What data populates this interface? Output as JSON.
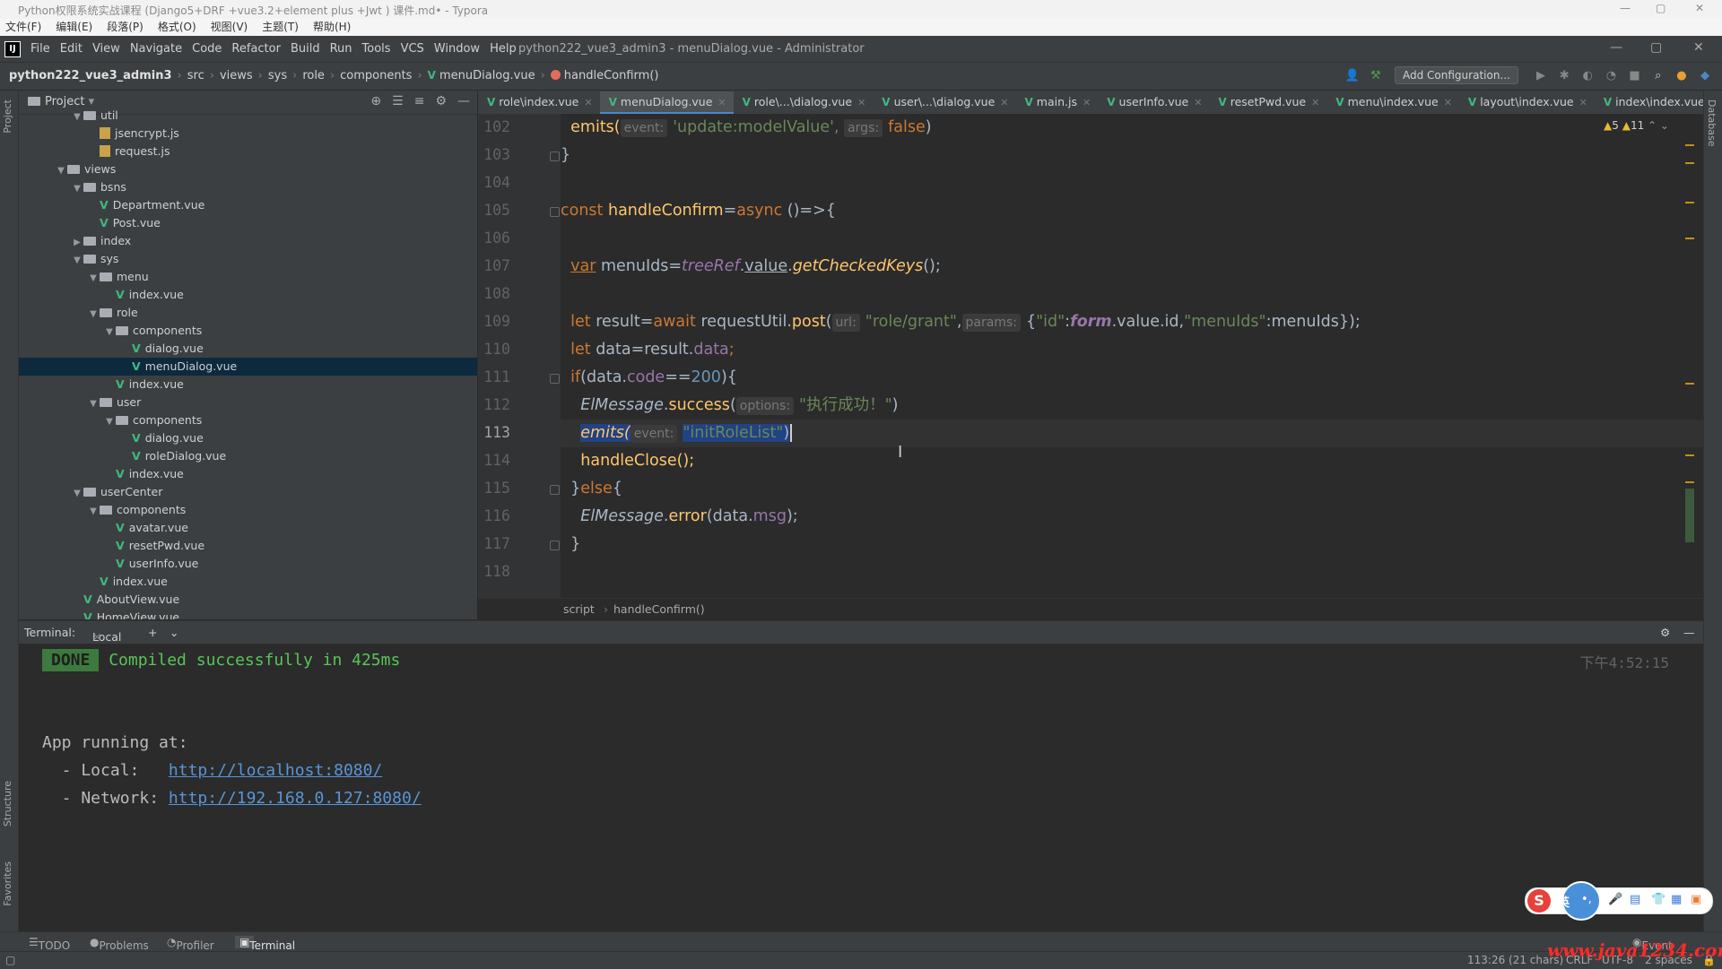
{
  "typora": {
    "title": "Python权限系统实战课程 (Django5+DRF +vue3.2+element plus +Jwt ) 课件.md• - Typora",
    "menu": [
      "文件(F)",
      "编辑(E)",
      "段落(P)",
      "格式(O)",
      "视图(V)",
      "主题(T)",
      "帮助(H)"
    ]
  },
  "ide": {
    "menu": [
      "File",
      "Edit",
      "View",
      "Navigate",
      "Code",
      "Refactor",
      "Build",
      "Run",
      "Tools",
      "VCS",
      "Window",
      "Help"
    ],
    "window_title": "python222_vue3_admin3 - menuDialog.vue - Administrator",
    "breadcrumb": [
      "python222_vue3_admin3",
      "src",
      "views",
      "sys",
      "role",
      "components",
      "menuDialog.vue",
      "handleConfirm()"
    ],
    "add_config_label": "Add Configuration..."
  },
  "project": {
    "label": "Project",
    "tree": [
      {
        "name": "util",
        "type": "folder",
        "depth": 2,
        "expanded": true
      },
      {
        "name": "jsencrypt.js",
        "type": "js",
        "depth": 3
      },
      {
        "name": "request.js",
        "type": "js",
        "depth": 3
      },
      {
        "name": "views",
        "type": "folder",
        "depth": 1,
        "expanded": true
      },
      {
        "name": "bsns",
        "type": "folder",
        "depth": 2,
        "expanded": true
      },
      {
        "name": "Department.vue",
        "type": "vue",
        "depth": 3
      },
      {
        "name": "Post.vue",
        "type": "vue",
        "depth": 3
      },
      {
        "name": "index",
        "type": "folder",
        "depth": 2,
        "expanded": false
      },
      {
        "name": "sys",
        "type": "folder",
        "depth": 2,
        "expanded": true
      },
      {
        "name": "menu",
        "type": "folder",
        "depth": 3,
        "expanded": true
      },
      {
        "name": "index.vue",
        "type": "vue",
        "depth": 4
      },
      {
        "name": "role",
        "type": "folder",
        "depth": 3,
        "expanded": true
      },
      {
        "name": "components",
        "type": "folder",
        "depth": 4,
        "expanded": true
      },
      {
        "name": "dialog.vue",
        "type": "vue",
        "depth": 5
      },
      {
        "name": "menuDialog.vue",
        "type": "vue",
        "depth": 5,
        "selected": true
      },
      {
        "name": "index.vue",
        "type": "vue",
        "depth": 4
      },
      {
        "name": "user",
        "type": "folder",
        "depth": 3,
        "expanded": true
      },
      {
        "name": "components",
        "type": "folder",
        "depth": 4,
        "expanded": true
      },
      {
        "name": "dialog.vue",
        "type": "vue",
        "depth": 5
      },
      {
        "name": "roleDialog.vue",
        "type": "vue",
        "depth": 5
      },
      {
        "name": "index.vue",
        "type": "vue",
        "depth": 4
      },
      {
        "name": "userCenter",
        "type": "folder",
        "depth": 2,
        "expanded": true
      },
      {
        "name": "components",
        "type": "folder",
        "depth": 3,
        "expanded": true
      },
      {
        "name": "avatar.vue",
        "type": "vue",
        "depth": 4
      },
      {
        "name": "resetPwd.vue",
        "type": "vue",
        "depth": 4
      },
      {
        "name": "userInfo.vue",
        "type": "vue",
        "depth": 4
      },
      {
        "name": "index.vue",
        "type": "vue",
        "depth": 3
      },
      {
        "name": "AboutView.vue",
        "type": "vue",
        "depth": 2
      },
      {
        "name": "HomeView.vue",
        "type": "vue",
        "depth": 2
      }
    ]
  },
  "tabs": [
    {
      "label": "role\\index.vue",
      "active": false
    },
    {
      "label": "menuDialog.vue",
      "active": true
    },
    {
      "label": "role\\...\\dialog.vue",
      "active": false
    },
    {
      "label": "user\\...\\dialog.vue",
      "active": false
    },
    {
      "label": "main.js",
      "active": false
    },
    {
      "label": "userInfo.vue",
      "active": false
    },
    {
      "label": "resetPwd.vue",
      "active": false
    },
    {
      "label": "menu\\index.vue",
      "active": false
    },
    {
      "label": "layout\\index.vue",
      "active": false
    },
    {
      "label": "index\\index.vue",
      "active": false
    }
  ],
  "editor": {
    "line_numbers": [
      "102",
      "103",
      "104",
      "105",
      "106",
      "107",
      "108",
      "109",
      "110",
      "111",
      "112",
      "113",
      "114",
      "115",
      "116",
      "117",
      "118"
    ],
    "current_line": "113",
    "warnings": "5",
    "weak_warnings": "11",
    "code": {
      "l102_fn": "emits(",
      "l102_hint": "event:",
      "l102_str": "'update:modelValue',",
      "l102_hint2": "args:",
      "l102_kw": "false",
      "l102_close": ")",
      "l103": "}",
      "l105_kw": "const",
      "l105_fn": "handleConfirm",
      "l105_eq": "=",
      "l105_async": "async",
      "l105_rest": " ()=>{",
      "l107_kw": "var",
      "l107_var": " menuIds=",
      "l107_obj": "treeRef",
      "l107_dot": ".",
      "l107_val": "value",
      "l107_dot2": ".",
      "l107_fn": "getCheckedKeys",
      "l107_end": "();",
      "l109_kw": "let",
      "l109_a": " result=",
      "l109_kw2": "await",
      "l109_b": " requestUtil.",
      "l109_fn": "post",
      "l109_c": "(",
      "l109_hint": "url:",
      "l109_str": "\"role/grant\"",
      "l109_d": ",",
      "l109_hint2": "params:",
      "l109_e": "{",
      "l109_s1": "\"id\"",
      "l109_f": ":",
      "l109_form": "form",
      "l109_g": ".",
      "l109_val": "value",
      "l109_h": ".id,",
      "l109_s2": "\"menuIds\"",
      "l109_i": ":menuIds});",
      "l110_kw": "let",
      "l110_a": " data=result.",
      "l110_p": "data",
      "l110_b": ";",
      "l111_kw": "if",
      "l111_a": "(data.",
      "l111_p": "code",
      "l111_b": "==",
      "l111_n": "200",
      "l111_c": "){",
      "l112_cls": "ElMessage",
      "l112_a": ".",
      "l112_fn": "success",
      "l112_b": "(",
      "l112_hint": "options:",
      "l112_str": "\"执行成功！\"",
      "l112_c": ")",
      "l113_fn": "emits(",
      "l113_hint": "event:",
      "l113_str": "\"initRoleList\"",
      "l113_c": ")",
      "l114": "handleClose();",
      "l115_a": "}",
      "l115_kw": "else",
      "l115_b": "{",
      "l116_cls": "ElMessage",
      "l116_a": ".",
      "l116_fn": "error",
      "l116_b": "(data.",
      "l116_p": "msg",
      "l116_c": ");",
      "l117": "}"
    },
    "breadcrumb": [
      "script",
      "handleConfirm()"
    ]
  },
  "terminal": {
    "label": "Terminal:",
    "tab": "Local",
    "done": "DONE",
    "compiled": "Compiled successfully in 425ms",
    "time": "下午4:52:15",
    "running": "App running at:",
    "local_label": "  - Local:   ",
    "local_url": "http://localhost:8080/",
    "network_label": "  - Network: ",
    "network_url": "http://192.168.0.127:8080/"
  },
  "toolbar": [
    "TODO",
    "Problems",
    "Profiler",
    "Terminal"
  ],
  "status": {
    "event_log": "Event Log",
    "position": "113:26 (21 chars)",
    "line_sep": "CRLF",
    "encoding": "UTF-8",
    "indent": "2 spaces"
  },
  "side_tabs": {
    "project": "Project",
    "structure": "Structure",
    "favorites": "Favorites",
    "database": "Database"
  },
  "watermark": "www.java1234.com",
  "colors": {
    "vue": "#41b883",
    "selection": "#214283",
    "accent": "#4a88c7"
  }
}
